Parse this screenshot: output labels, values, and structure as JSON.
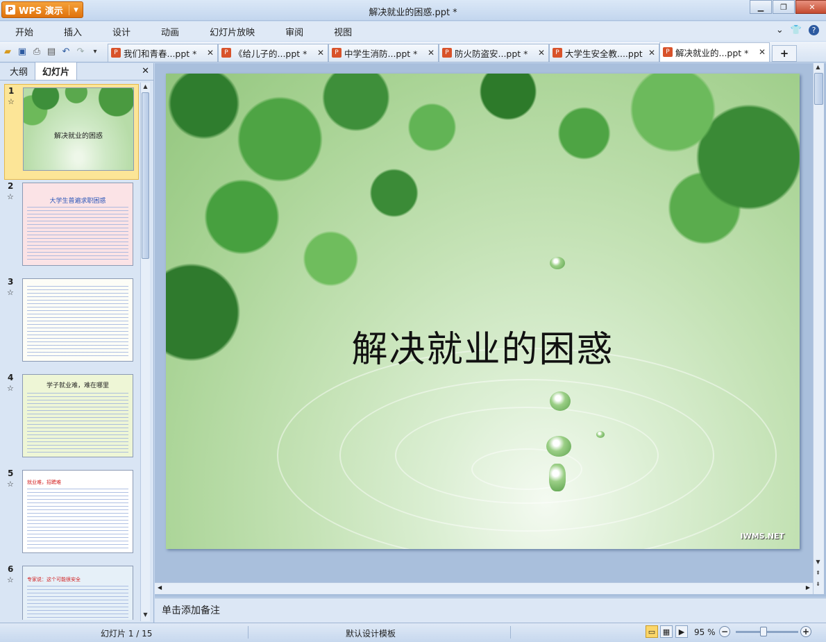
{
  "app": {
    "name": "WPS 演示",
    "window_title": "解决就业的困惑.ppt *"
  },
  "window_controls": {
    "minimize": "▁",
    "maximize": "❐",
    "close": "✕"
  },
  "menu": [
    "开始",
    "插入",
    "设计",
    "动画",
    "幻灯片放映",
    "审阅",
    "视图"
  ],
  "menu_right": {
    "collapse": "⌄",
    "skin": "👕",
    "help": "?"
  },
  "toolbar_icons": [
    "open-folder-icon",
    "save-icon",
    "print-icon",
    "print-preview-icon",
    "undo-icon",
    "redo-icon",
    "customize-icon"
  ],
  "tabs": [
    {
      "label": "我们和青春...ppt *",
      "active": false
    },
    {
      "label": "《给儿子的...ppt *",
      "active": false
    },
    {
      "label": "中学生消防...ppt *",
      "active": false
    },
    {
      "label": "防火防盗安...ppt *",
      "active": false
    },
    {
      "label": "大学生安全教....ppt *",
      "active": false
    },
    {
      "label": "解决就业的...ppt *",
      "active": true
    }
  ],
  "left_pane": {
    "tabs": [
      "大纲",
      "幻灯片"
    ],
    "active_tab": "幻灯片",
    "close": "✕"
  },
  "slides": [
    {
      "num": "1",
      "title": "解决就业的困惑"
    },
    {
      "num": "2",
      "title": "大学生普遍求职困惑"
    },
    {
      "num": "3",
      "title": ""
    },
    {
      "num": "4",
      "title": "学子就业难，难在哪里"
    },
    {
      "num": "5",
      "title": "就业难，招聘难"
    },
    {
      "num": "6",
      "title": "专家说：这个可能很安全"
    }
  ],
  "current_slide": {
    "title": "解决就业的困惑",
    "watermark": "IWMS.NET"
  },
  "notes_placeholder": "单击添加备注",
  "status": {
    "slide_counter": "幻灯片 1 / 15",
    "template": "默认设计模板",
    "zoom": "95 %"
  }
}
